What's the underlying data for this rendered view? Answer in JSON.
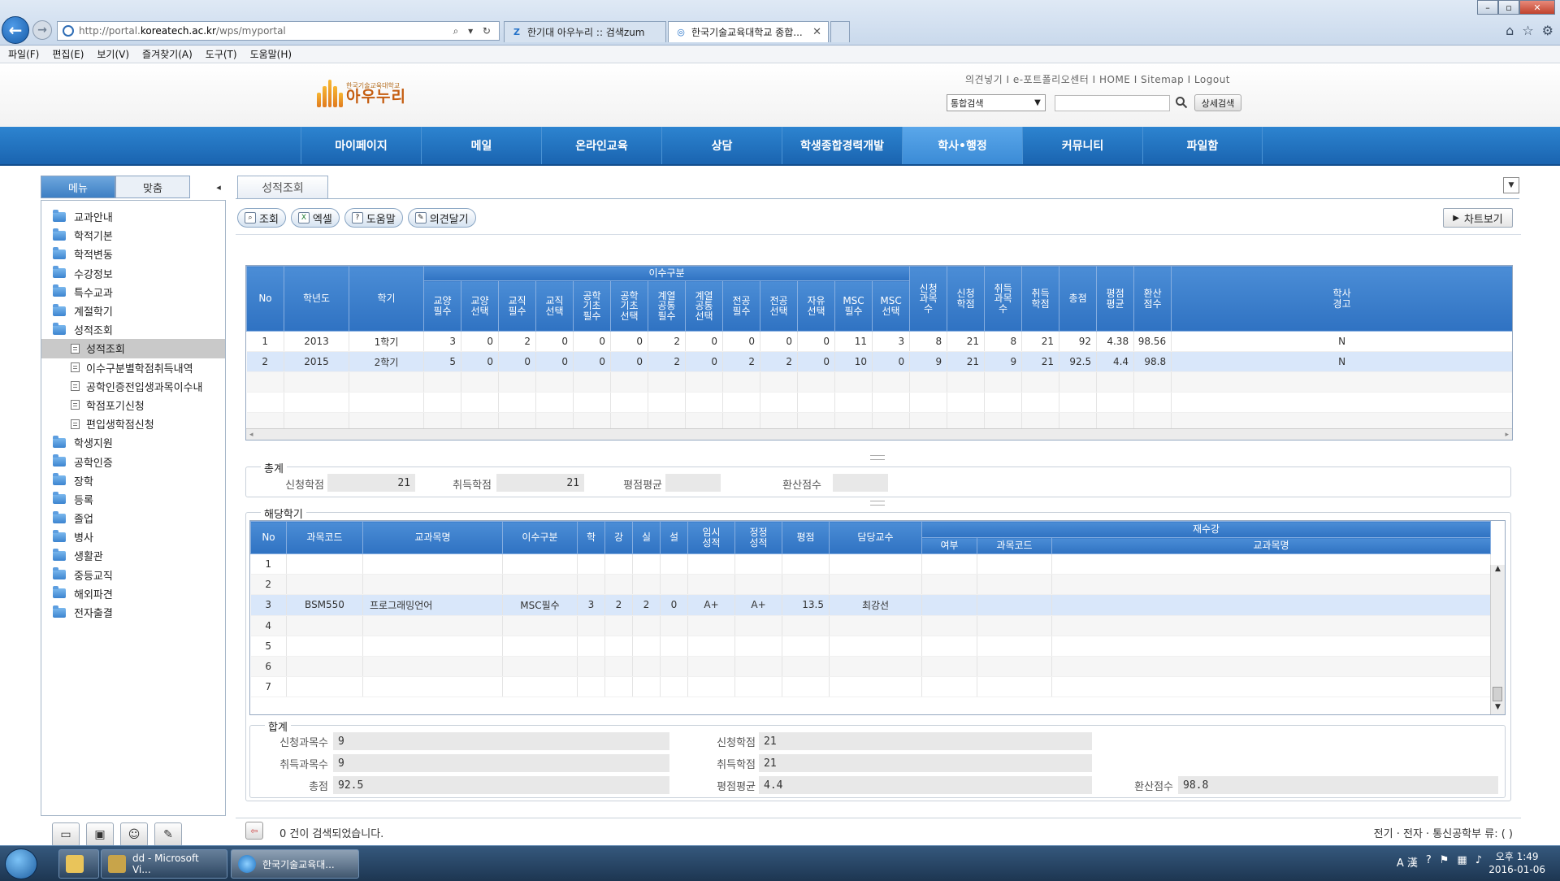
{
  "browser": {
    "url_prefix": "http://portal.",
    "url_domain": "koreatech.ac.kr",
    "url_path": "/wps/myportal",
    "tabs": [
      {
        "label": "한기대 아우누리 :: 검색zum"
      },
      {
        "label": "한국기술교육대학교 종합..."
      }
    ],
    "menu": [
      "파일(F)",
      "편집(E)",
      "보기(V)",
      "즐겨찾기(A)",
      "도구(T)",
      "도움말(H)"
    ]
  },
  "header": {
    "logo_sub": "한국기술교육대학교",
    "logo_main": "아우누리",
    "util_links": "의견넣기 I e-포트폴리오센터 I HOME I Sitemap I Logout",
    "search_scope": "통합검색",
    "adv_search_label": "상세검색"
  },
  "nav": {
    "items": [
      "마이페이지",
      "메일",
      "온라인교육",
      "상담",
      "학생종합경력개발",
      "학사•행정",
      "커뮤니티",
      "파일함"
    ],
    "active_index": 5
  },
  "sidebar": {
    "tabs": [
      "메뉴",
      "맞춤"
    ],
    "collapse_glyph": "◂",
    "tree": [
      {
        "label": "교과안내",
        "type": "folder"
      },
      {
        "label": "학적기본",
        "type": "folder"
      },
      {
        "label": "학적변동",
        "type": "folder"
      },
      {
        "label": "수강정보",
        "type": "folder"
      },
      {
        "label": "특수교과",
        "type": "folder"
      },
      {
        "label": "계절학기",
        "type": "folder"
      },
      {
        "label": "성적조회",
        "type": "folder"
      },
      {
        "label": "성적조회",
        "type": "doc",
        "selected": true
      },
      {
        "label": "이수구분별학점취득내역",
        "type": "doc"
      },
      {
        "label": "공학인증전입생과목이수내",
        "type": "doc"
      },
      {
        "label": "학점포기신청",
        "type": "doc"
      },
      {
        "label": "편입생학점신청",
        "type": "doc"
      },
      {
        "label": "학생지원",
        "type": "folder"
      },
      {
        "label": "공학인증",
        "type": "folder"
      },
      {
        "label": "장학",
        "type": "folder"
      },
      {
        "label": "등록",
        "type": "folder"
      },
      {
        "label": "졸업",
        "type": "folder"
      },
      {
        "label": "병사",
        "type": "folder"
      },
      {
        "label": "생활관",
        "type": "folder"
      },
      {
        "label": "중등교직",
        "type": "folder"
      },
      {
        "label": "해외파견",
        "type": "folder"
      },
      {
        "label": "전자출결",
        "type": "folder"
      }
    ]
  },
  "content": {
    "page_tab": "성적조회",
    "toolbar": {
      "query": "조회",
      "excel": "엑셀",
      "help": "도움말",
      "feedback": "의견달기"
    },
    "chart_label": "차트보기",
    "grid1": {
      "headers": {
        "no": "No",
        "year": "학년도",
        "term": "학기",
        "group": "이수구분",
        "sub": [
          "교양\n필수",
          "교양\n선택",
          "교직\n필수",
          "교직\n선택",
          "공학\n기초\n필수",
          "공학\n기초\n선택",
          "계열\n공통\n필수",
          "계열\n공통\n선택",
          "전공\n필수",
          "전공\n선택",
          "자유\n선택",
          "MSC\n필수",
          "MSC\n선택"
        ],
        "tail": [
          "신청\n과목\n수",
          "신청\n학점",
          "취득\n과목\n수",
          "취득\n학점",
          "총점",
          "평점\n평균",
          "환산\n점수",
          "학사\n경고"
        ]
      },
      "rows": [
        {
          "no": "1",
          "year": "2013",
          "term": "1학기",
          "vals": [
            "3",
            "0",
            "2",
            "0",
            "0",
            "0",
            "2",
            "0",
            "0",
            "0",
            "0",
            "11",
            "3"
          ],
          "tail": [
            "8",
            "21",
            "8",
            "21",
            "92",
            "4.38",
            "98.56",
            "N"
          ]
        },
        {
          "no": "2",
          "year": "2015",
          "term": "2학기",
          "vals": [
            "5",
            "0",
            "0",
            "0",
            "0",
            "0",
            "2",
            "0",
            "2",
            "2",
            "0",
            "10",
            "0"
          ],
          "tail": [
            "9",
            "21",
            "9",
            "21",
            "92.5",
            "4.4",
            "98.8",
            "N"
          ]
        }
      ]
    },
    "summary": {
      "legend": "총계",
      "applied_credits_label": "신청학점",
      "applied_credits": "21",
      "earned_credits_label": "취득학점",
      "earned_credits": "21",
      "gpa_label": "평점평균",
      "gpa": "",
      "converted_label": "환산점수",
      "converted": ""
    },
    "semester": {
      "legend": "해당학기"
    },
    "grid2": {
      "headers": {
        "no": "No",
        "code": "과목코드",
        "name": "교과목명",
        "category": "이수구분",
        "credit": "학",
        "lecture": "강",
        "lab": "실",
        "design": "설",
        "temp_grade": "임시\n성적",
        "final_grade": "정정\n성적",
        "points": "평점",
        "professor": "담당교수",
        "retake": "재수강",
        "retake_flag": "여부",
        "retake_code": "과목코드",
        "retake_name": "교과목명"
      },
      "rows": [
        {
          "no": "1",
          "code": "",
          "name": "",
          "category": "",
          "credit": "",
          "lecture": "",
          "lab": "",
          "design": "",
          "temp": "",
          "final": "",
          "points": "",
          "prof": ""
        },
        {
          "no": "2",
          "code": "",
          "name": "",
          "category": "",
          "credit": "",
          "lecture": "",
          "lab": "",
          "design": "",
          "temp": "",
          "final": "",
          "points": "",
          "prof": ""
        },
        {
          "no": "3",
          "code": "BSM550",
          "name": "프로그래밍언어",
          "category": "MSC필수",
          "credit": "3",
          "lecture": "2",
          "lab": "2",
          "design": "0",
          "temp": "A+",
          "final": "A+",
          "points": "13.5",
          "prof": "최강선"
        },
        {
          "no": "4",
          "code": "",
          "name": "",
          "category": "",
          "credit": "",
          "lecture": "",
          "lab": "",
          "design": "",
          "temp": "",
          "final": "",
          "points": "",
          "prof": ""
        },
        {
          "no": "5",
          "code": "",
          "name": "",
          "category": "",
          "credit": "",
          "lecture": "",
          "lab": "",
          "design": "",
          "temp": "",
          "final": "",
          "points": "",
          "prof": ""
        },
        {
          "no": "6",
          "code": "",
          "name": "",
          "category": "",
          "credit": "",
          "lecture": "",
          "lab": "",
          "design": "",
          "temp": "",
          "final": "",
          "points": "",
          "prof": ""
        },
        {
          "no": "7",
          "code": "",
          "name": "",
          "category": "",
          "credit": "",
          "lecture": "",
          "lab": "",
          "design": "",
          "temp": "",
          "final": "",
          "points": "",
          "prof": ""
        }
      ]
    },
    "totals": {
      "legend": "합계",
      "applied_courses_label": "신청과목수",
      "applied_courses": "9",
      "earned_courses_label": "취득과목수",
      "earned_courses": "9",
      "total_label": "총점",
      "total": "92.5",
      "applied_credits_label": "신청학점",
      "applied_credits": "21",
      "earned_credits_label": "취득학점",
      "earned_credits": "21",
      "gpa_label": "평점평균",
      "gpa": "4.4",
      "converted_label": "환산점수",
      "converted": "98.8"
    },
    "status_text": "0 건이 검색되었습니다.",
    "status_right": "전기 · 전자 · 통신공학부 류:      (        )"
  },
  "taskbar": {
    "items": [
      "dd - Microsoft Vi...",
      "한국기술교육대..."
    ],
    "tray": "A 漢",
    "time": "오후 1:49",
    "date": "2016-01-06"
  },
  "colors": {
    "nav_blue": "#1a64b0",
    "header_blue": "#3c7fca",
    "selected_row": "#d9e7fa"
  }
}
